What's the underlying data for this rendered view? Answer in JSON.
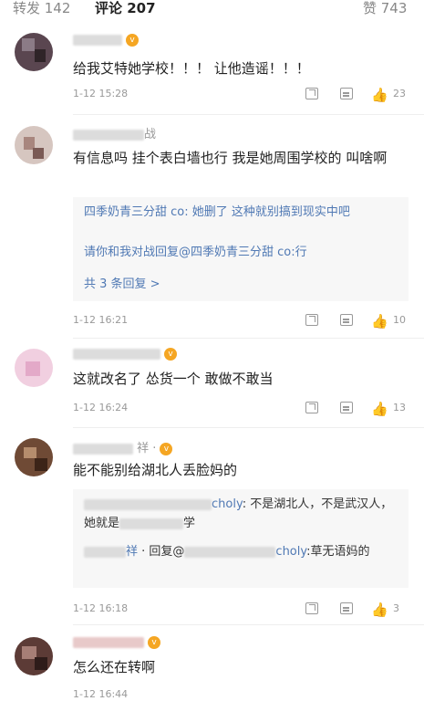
{
  "tabs": {
    "repost": "转发 142",
    "comments": "评论 207",
    "likes": "赞 743"
  },
  "accent_color": "#ff8200",
  "link_color": "#5079b4",
  "comments": [
    {
      "name_suffix": "",
      "has_badge": true,
      "text": "给我艾特她学校！！！ 让他造谣！！！",
      "time": "1-12 15:28",
      "likes": "23"
    },
    {
      "name_suffix": "战",
      "has_badge": false,
      "text": "有信息吗 挂个表白墙也行 我是她周围学校的 叫啥啊",
      "replies": [
        {
          "text": "四季奶青三分甜 co: 她删了 这种就别搞到现实中吧"
        },
        {
          "text": "请你和我对战回复@四季奶青三分甜 co:行"
        }
      ],
      "more_replies": "共 3 条回复 >",
      "time": "1-12 16:21",
      "likes": "10"
    },
    {
      "name_suffix": "",
      "has_badge": true,
      "text": "这就改名了 怂货一个 敢做不敢当",
      "time": "1-12 16:24",
      "likes": "13"
    },
    {
      "name_suffix": "",
      "has_badge": true,
      "text": "能不能别给湖北人丢脸妈的",
      "replies": [
        {
          "user": "choly",
          "text": ": 不是湖北人，不是武汉人，她就是",
          "text_tail": "学"
        },
        {
          "user_a": "祥",
          "middle": " · 回复@",
          "user_b": "choly",
          "text": ":草无语妈的"
        }
      ],
      "time": "1-12 16:18",
      "likes": "3"
    },
    {
      "name_suffix": "",
      "has_badge": true,
      "text": "怎么还在转啊",
      "time": "1-12 16:44"
    }
  ],
  "icons": [
    "share-icon",
    "reply-icon",
    "like-icon",
    "vip-badge-icon"
  ]
}
